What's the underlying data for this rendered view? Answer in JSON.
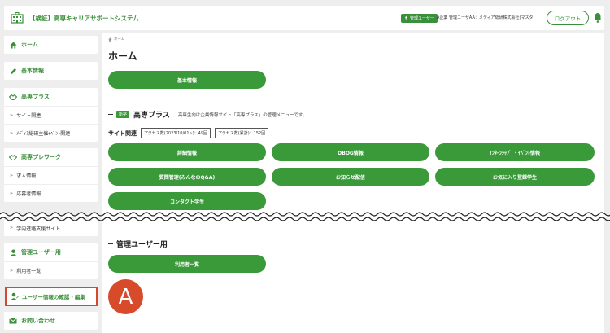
{
  "header": {
    "title": "【検証】高専キャリアサポートシステム",
    "admin_badge": "管理ユーザー",
    "user_name": "A企業 管理ユーザAA：メディア総研株式会社(マスタ)",
    "logout_label": "ログアウト"
  },
  "sidebar": {
    "home": "ホーム",
    "basic_info": "基本情報",
    "kosen_plus": {
      "label": "高専プラス",
      "items": [
        "サイト関連",
        "ﾒﾃﾞｨｱ総研主催ｲﾍﾞﾝﾄ関連"
      ]
    },
    "kosen_prework": {
      "label": "高専プレワーク",
      "items": [
        "求人情報",
        "応募者情報"
      ]
    },
    "career_site": "学内進路支援サイト",
    "admin_users": {
      "label": "管理ユーザー用",
      "items": [
        "利用者一覧"
      ]
    },
    "user_info_edit": "ユーザー情報の確認・編集",
    "contact": "お問い合わせ"
  },
  "main": {
    "breadcrumb": "ホーム",
    "title": "ホーム",
    "basic_info_button": "基本情報",
    "kosen_plus_section": {
      "tag": "新卒",
      "title": "高専プラス",
      "desc": "高専生向け企業情報サイト「高専プラス」の管理メニューです。",
      "sub_label": "サイト関連",
      "stat_period": "アクセス数(2023/10/01~)：49回",
      "stat_total": "アクセス数(累計)：152回",
      "buttons": [
        "詳細情報",
        "OBOG情報",
        "ｲﾝﾀｰﾝｼｯﾌﾟ ・ｲﾍﾞﾝﾄ情報",
        "質問管理(みんなのQ&A)",
        "お知らせ配信",
        "お気に入り登録学生",
        "コンタクト学生"
      ]
    },
    "admin_section": {
      "title": "管理ユーザー用",
      "buttons": [
        "利用者一覧"
      ]
    },
    "avatar_letter": "A"
  },
  "colors": {
    "brand": "#3a9a3a",
    "highlight": "#d14a2a",
    "avatar": "#d74a2a"
  }
}
